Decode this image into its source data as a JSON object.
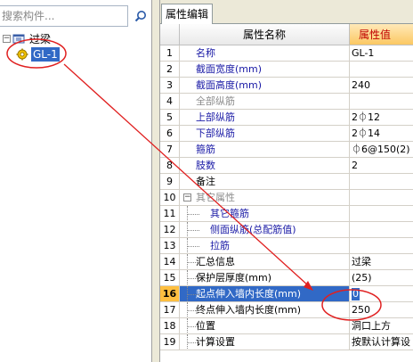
{
  "search": {
    "placeholder": "搜索构件..."
  },
  "tree": {
    "root": {
      "label": "过梁",
      "expander": "−"
    },
    "child": {
      "label": "GL-1"
    }
  },
  "tab": {
    "label": "属性编辑"
  },
  "grid": {
    "header": {
      "name": "属性名称",
      "value": "属性值"
    },
    "rows": [
      {
        "num": "1",
        "name": "名称",
        "value": "GL-1"
      },
      {
        "num": "2",
        "name": "截面宽度(mm)",
        "value": ""
      },
      {
        "num": "3",
        "name": "截面高度(mm)",
        "value": "240"
      },
      {
        "num": "4",
        "name": "全部纵筋",
        "value": ""
      },
      {
        "num": "5",
        "name": "上部纵筋",
        "value": "2⏀12"
      },
      {
        "num": "6",
        "name": "下部纵筋",
        "value": "2⏀14"
      },
      {
        "num": "7",
        "name": "箍筋",
        "value": "⏀6@150(2)"
      },
      {
        "num": "8",
        "name": "肢数",
        "value": "2"
      },
      {
        "num": "9",
        "name": "备注",
        "value": ""
      },
      {
        "num": "10",
        "name": "其它属性",
        "value": "",
        "toggle": "−"
      },
      {
        "num": "11",
        "name": "其它箍筋",
        "value": ""
      },
      {
        "num": "12",
        "name": "侧面纵筋(总配筋值)",
        "value": ""
      },
      {
        "num": "13",
        "name": "拉筋",
        "value": ""
      },
      {
        "num": "14",
        "name": "汇总信息",
        "value": "过梁"
      },
      {
        "num": "15",
        "name": "保护层厚度(mm)",
        "value": "(25)"
      },
      {
        "num": "16",
        "name": "起点伸入墙内长度(mm)",
        "value": "0"
      },
      {
        "num": "17",
        "name": "终点伸入墙内长度(mm)",
        "value": "250"
      },
      {
        "num": "18",
        "name": "位置",
        "value": "洞口上方"
      },
      {
        "num": "19",
        "name": "计算设置",
        "value": "按默认计算设"
      }
    ]
  },
  "colors": {
    "selection": "#3169c6",
    "annotation": "#e02020",
    "header_accent": "#fbc863"
  },
  "icons": {
    "search": "search-icon",
    "folder": "folder-icon",
    "component": "gear-icon"
  }
}
